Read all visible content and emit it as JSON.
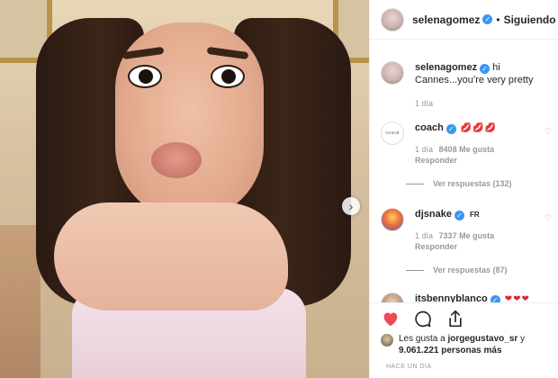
{
  "post": {
    "author": "selenagomez",
    "follow_status": "Siguiendo",
    "separator": "•"
  },
  "comments": [
    {
      "user": "selenagomez",
      "text": "hi Cannes...you’re very pretty",
      "time": "1 día"
    },
    {
      "user": "coach",
      "emoji": "💋💋💋",
      "time": "1 día",
      "likes": "8408 Me gusta",
      "reply": "Responder",
      "view_replies": "Ver respuestas (132)"
    },
    {
      "user": "djsnake",
      "flag": "FR",
      "time": "1 día",
      "likes": "7337 Me gusta",
      "reply": "Responder",
      "view_replies": "Ver respuestas (87)"
    },
    {
      "user": "itsbennyblanco",
      "emoji": "❤❤❤"
    }
  ],
  "likes": {
    "prefix": "Les gusta a ",
    "user": "jorgegustavo_sr",
    "mid": " y",
    "count": "9.061.221 personas más"
  },
  "timestamp": "HACE UN DÍA",
  "icons": {
    "heart": "heart-icon",
    "comment": "comment-icon",
    "share": "share-icon",
    "next": "chevron-right-icon",
    "verified": "verified-badge-icon"
  },
  "colors": {
    "heart_red": "#ed4956",
    "verified_blue": "#3897f0",
    "muted": "#999999"
  },
  "next_glyph": "›"
}
